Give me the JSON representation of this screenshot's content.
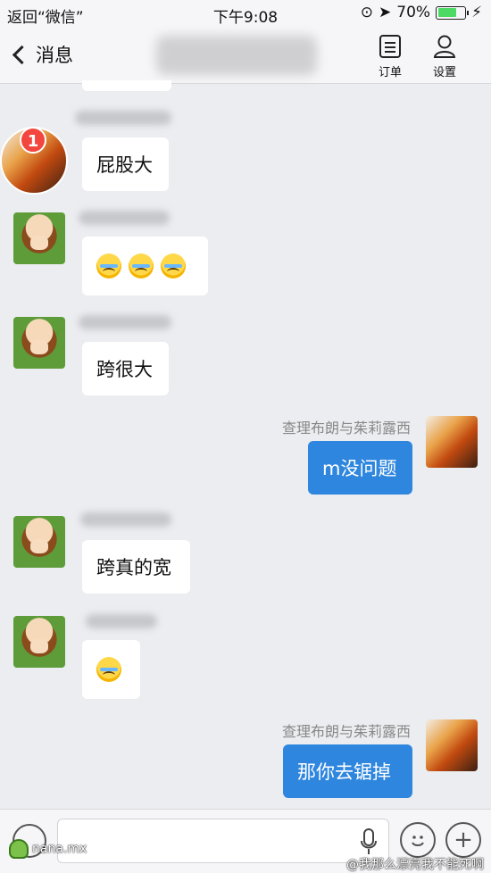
{
  "status_bar": {
    "back_app": "返回“微信”",
    "time": "下午9:08",
    "battery": "70%",
    "battery_level": 0.7
  },
  "nav": {
    "back_label": "消息",
    "order_label": "订单",
    "settings_label": "设置"
  },
  "messages": {
    "m1": {
      "text": "屁股大",
      "badge": "1"
    },
    "m3": {
      "text": "跨很大"
    },
    "m4": {
      "sender": "查理布朗与茱莉露西",
      "text": "m没问题"
    },
    "m5": {
      "text": "跨真的宽"
    },
    "m7": {
      "sender": "查理布朗与茱莉露西",
      "text": "那你去锯掉"
    }
  },
  "watermarks": {
    "left": "nana.mx",
    "right": "@我那么漂亮我不能死啊"
  }
}
